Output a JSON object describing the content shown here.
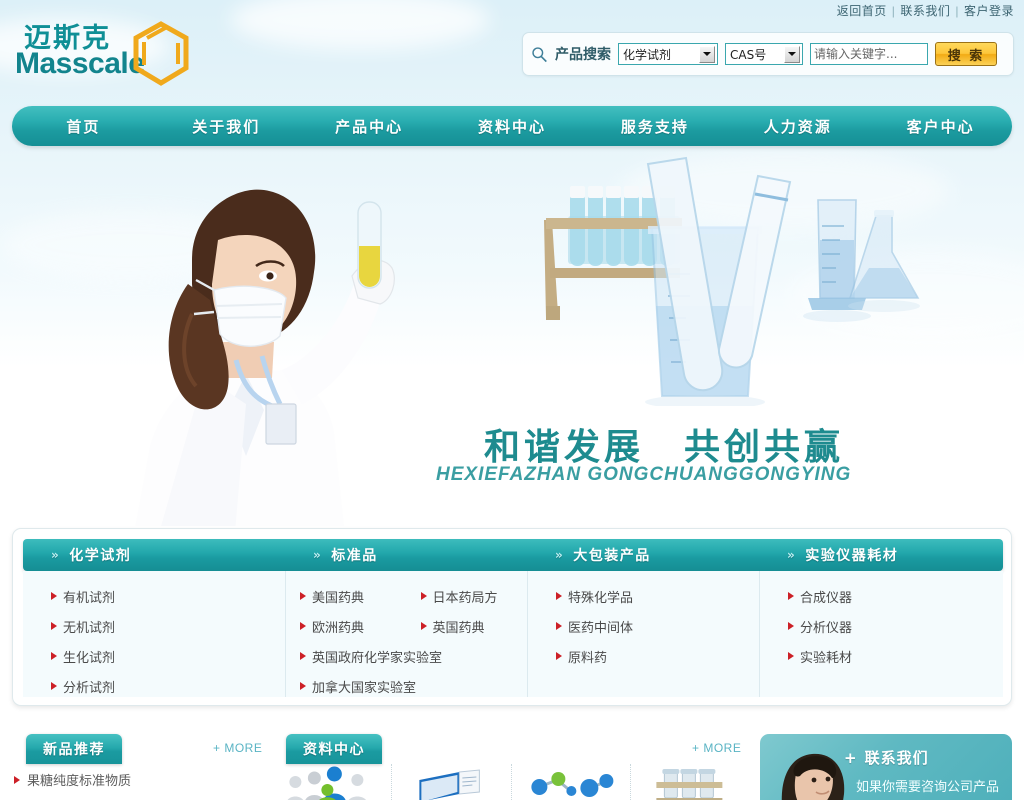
{
  "brand": {
    "name_cn": "迈斯克",
    "name_en": "Masscale",
    "logo_icon": "hexagon-benzene-icon",
    "accent_teal": "#1a9aa0",
    "accent_orange": "#f2ab14",
    "bullet_red": "#cc2027"
  },
  "toplinks": [
    {
      "label": "返回首页",
      "name": "top-link-home"
    },
    {
      "label": "联系我们",
      "name": "top-link-contact"
    },
    {
      "label": "客户登录",
      "name": "top-link-login"
    }
  ],
  "separator": "|",
  "search": {
    "icon": "search-icon",
    "label": "产品搜索",
    "category_select": "化学试剂",
    "field_select": "CAS号",
    "placeholder": "请输入关键字...",
    "input_value": "",
    "button_label": "搜 索"
  },
  "nav": [
    {
      "label": "首页",
      "name": "nav-home"
    },
    {
      "label": "关于我们",
      "name": "nav-about"
    },
    {
      "label": "产品中心",
      "name": "nav-products"
    },
    {
      "label": "资料中心",
      "name": "nav-resources"
    },
    {
      "label": "服务支持",
      "name": "nav-support"
    },
    {
      "label": "人力资源",
      "name": "nav-hr"
    },
    {
      "label": "客户中心",
      "name": "nav-customer"
    }
  ],
  "banner": {
    "slogan_cn": "和谐发展　共创共赢",
    "slogan_en": "HEXIEFAZHAN  GONGCHUANGGONGYING",
    "imagery": "scientist-with-test-tube and lab-glassware"
  },
  "categories": [
    {
      "header": "化学试剂",
      "items": [
        "有机试剂",
        "无机试剂",
        "生化试剂",
        "分析试剂"
      ]
    },
    {
      "header": "标准品",
      "items": [
        "美国药典",
        "日本药局方",
        "欧洲药典",
        "英国药典",
        "英国政府化学家实验室",
        "加拿大国家实验室"
      ]
    },
    {
      "header": "大包装产品",
      "items": [
        "特殊化学品",
        "医药中间体",
        "原料药"
      ]
    },
    {
      "header": "实验仪器耗材",
      "items": [
        "合成仪器",
        "分析仪器",
        "实验耗材"
      ]
    }
  ],
  "bottom": {
    "tab_new_products": "新品推荐",
    "tab_resources": "资料中心",
    "more_label": "+ MORE",
    "new_product_items": [
      "果糖纯度标准物质"
    ],
    "thumbnails": [
      "people-group-icon",
      "book-document-icon",
      "molecule-icon",
      "test-tube-rack-icon"
    ]
  },
  "contact": {
    "plus": "+",
    "title": "联系我们",
    "subtitle": "如果你需要咨询公司产品",
    "avatar": "customer-service-agent-photo"
  }
}
